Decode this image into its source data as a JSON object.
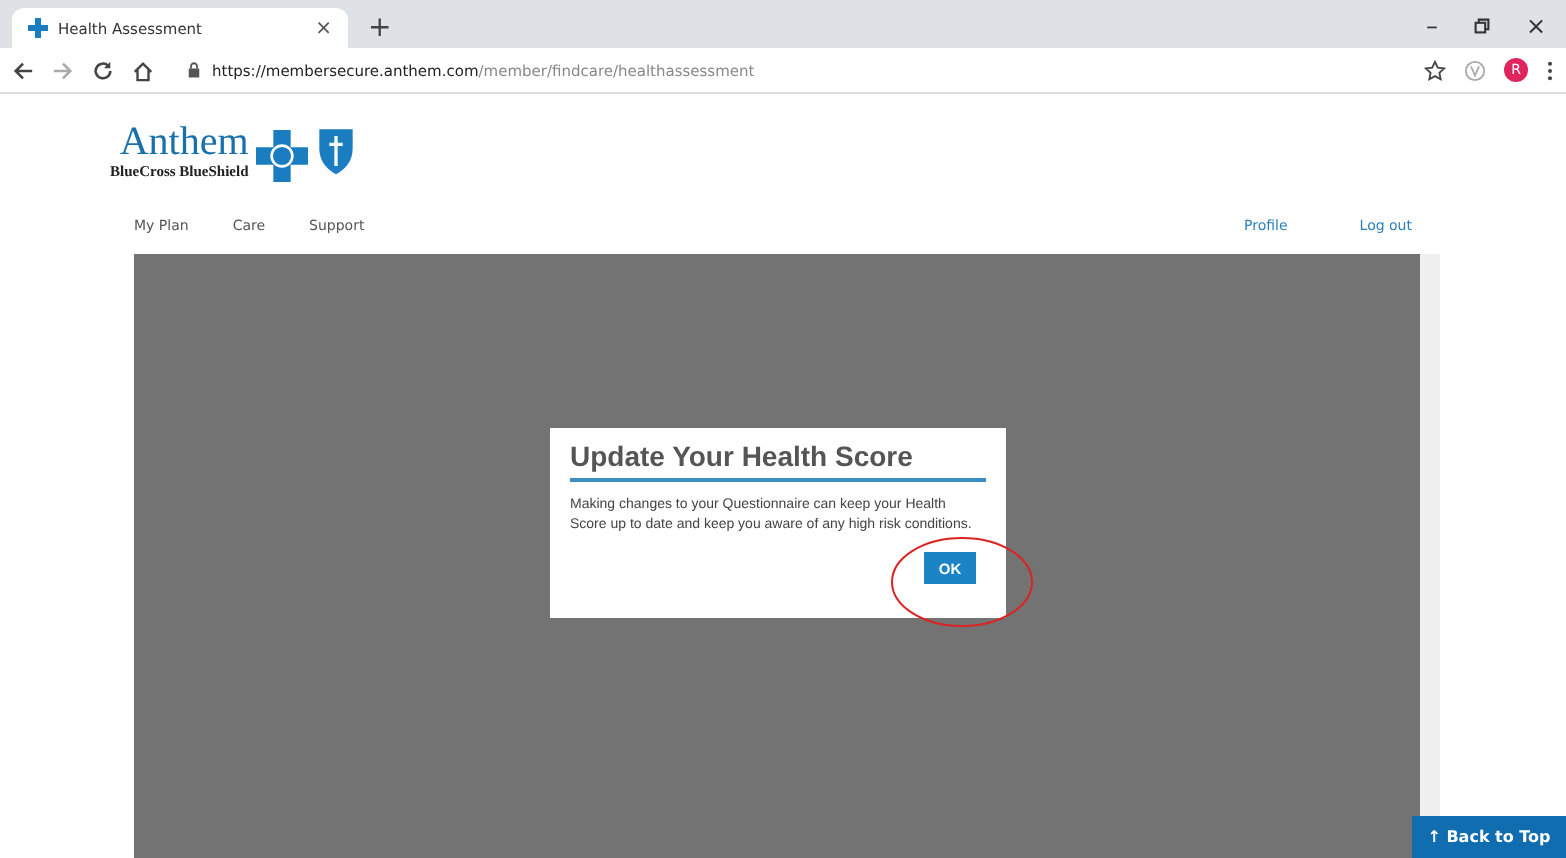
{
  "browser": {
    "tab_title": "Health Assessment",
    "tab_close": "×",
    "new_tab": "+",
    "url_host": "https://membersecure.anthem.com",
    "url_path": "/member/findcare/healthassessment",
    "profile_initial": "R",
    "minimize": "–",
    "close": "×"
  },
  "logo": {
    "name": "Anthem",
    "tagline": "BlueCross BlueShield"
  },
  "nav": {
    "left": [
      {
        "label": "My Plan"
      },
      {
        "label": "Care"
      },
      {
        "label": "Support"
      }
    ],
    "right": [
      {
        "label": "Profile"
      },
      {
        "label": "Log out"
      }
    ]
  },
  "dialog": {
    "title": "Update Your Health Score",
    "body": "Making changes to your Questionnaire can keep your Health Score up to date and keep you aware of any high risk conditions.",
    "button": "OK"
  },
  "back_to_top": "↑ Back to Top"
}
